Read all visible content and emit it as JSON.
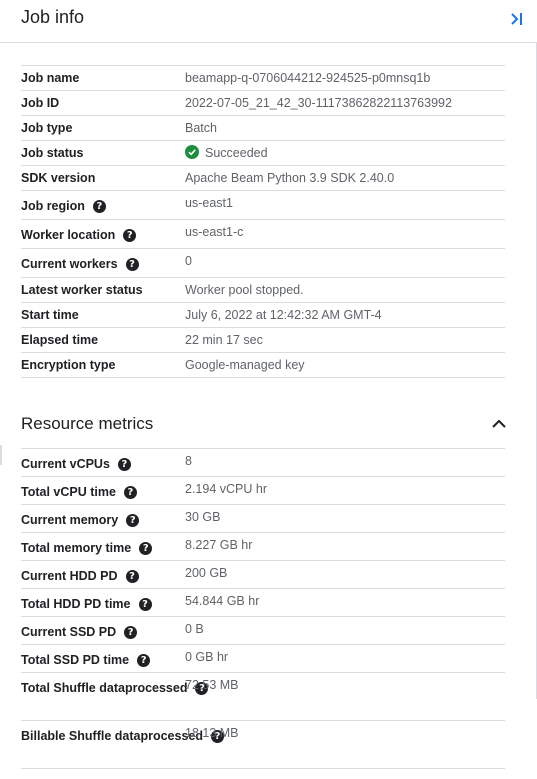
{
  "header": {
    "title": "Job info",
    "collapse_icon": "collapse-panel-icon"
  },
  "job_info": [
    {
      "key": "Job name",
      "value": "beamapp-q-0706044212-924525-p0mnsq1b",
      "help": false
    },
    {
      "key": "Job ID",
      "value": "2022-07-05_21_42_30-11173862822113763992",
      "help": false
    },
    {
      "key": "Job type",
      "value": "Batch",
      "help": false
    },
    {
      "key": "Job status",
      "value": "Succeeded",
      "help": false,
      "status_color": "#1e8e3e"
    },
    {
      "key": "SDK version",
      "value": "Apache Beam Python 3.9 SDK 2.40.0",
      "help": false
    },
    {
      "key": "Job region",
      "value": "us-east1",
      "help": true
    },
    {
      "key": "Worker location",
      "value": "us-east1-c",
      "help": true
    },
    {
      "key": "Current workers",
      "value": "0",
      "help": true
    },
    {
      "key": "Latest worker status",
      "value": "Worker pool stopped.",
      "help": false
    },
    {
      "key": "Start time",
      "value": "July 6, 2022 at 12:42:32 AM GMT-4",
      "help": false
    },
    {
      "key": "Elapsed time",
      "value": "22 min 17 sec",
      "help": false
    },
    {
      "key": "Encryption type",
      "value": "Google-managed key",
      "help": false
    }
  ],
  "resource_metrics": {
    "title": "Resource metrics",
    "chevron_icon": "chevron-up-icon",
    "rows": [
      {
        "key": "Current vCPUs",
        "value": "8"
      },
      {
        "key": "Total vCPU time",
        "value": "2.194 vCPU hr"
      },
      {
        "key": "Current memory",
        "value": "30 GB"
      },
      {
        "key": "Total memory time",
        "value": "8.227 GB hr"
      },
      {
        "key": "Current HDD PD",
        "value": "200 GB"
      },
      {
        "key": "Total HDD PD time",
        "value": "54.844 GB hr"
      },
      {
        "key": "Current SSD PD",
        "value": "0 B"
      },
      {
        "key": "Total SSD PD time",
        "value": "0 GB hr"
      }
    ],
    "multi_rows": [
      {
        "key_line1": "Total Shuffle data",
        "key_line2": "processed",
        "value": "72.53 MB"
      },
      {
        "key_line1": "Billable Shuffle data",
        "key_line2": "processed",
        "value": "18.13 MB"
      }
    ]
  },
  "help_glyph": "?",
  "colors": {
    "accent": "#1a73e8",
    "success": "#1e8e3e",
    "divider": "#dadce0",
    "text_primary": "#202124",
    "text_secondary": "#5f6368"
  }
}
